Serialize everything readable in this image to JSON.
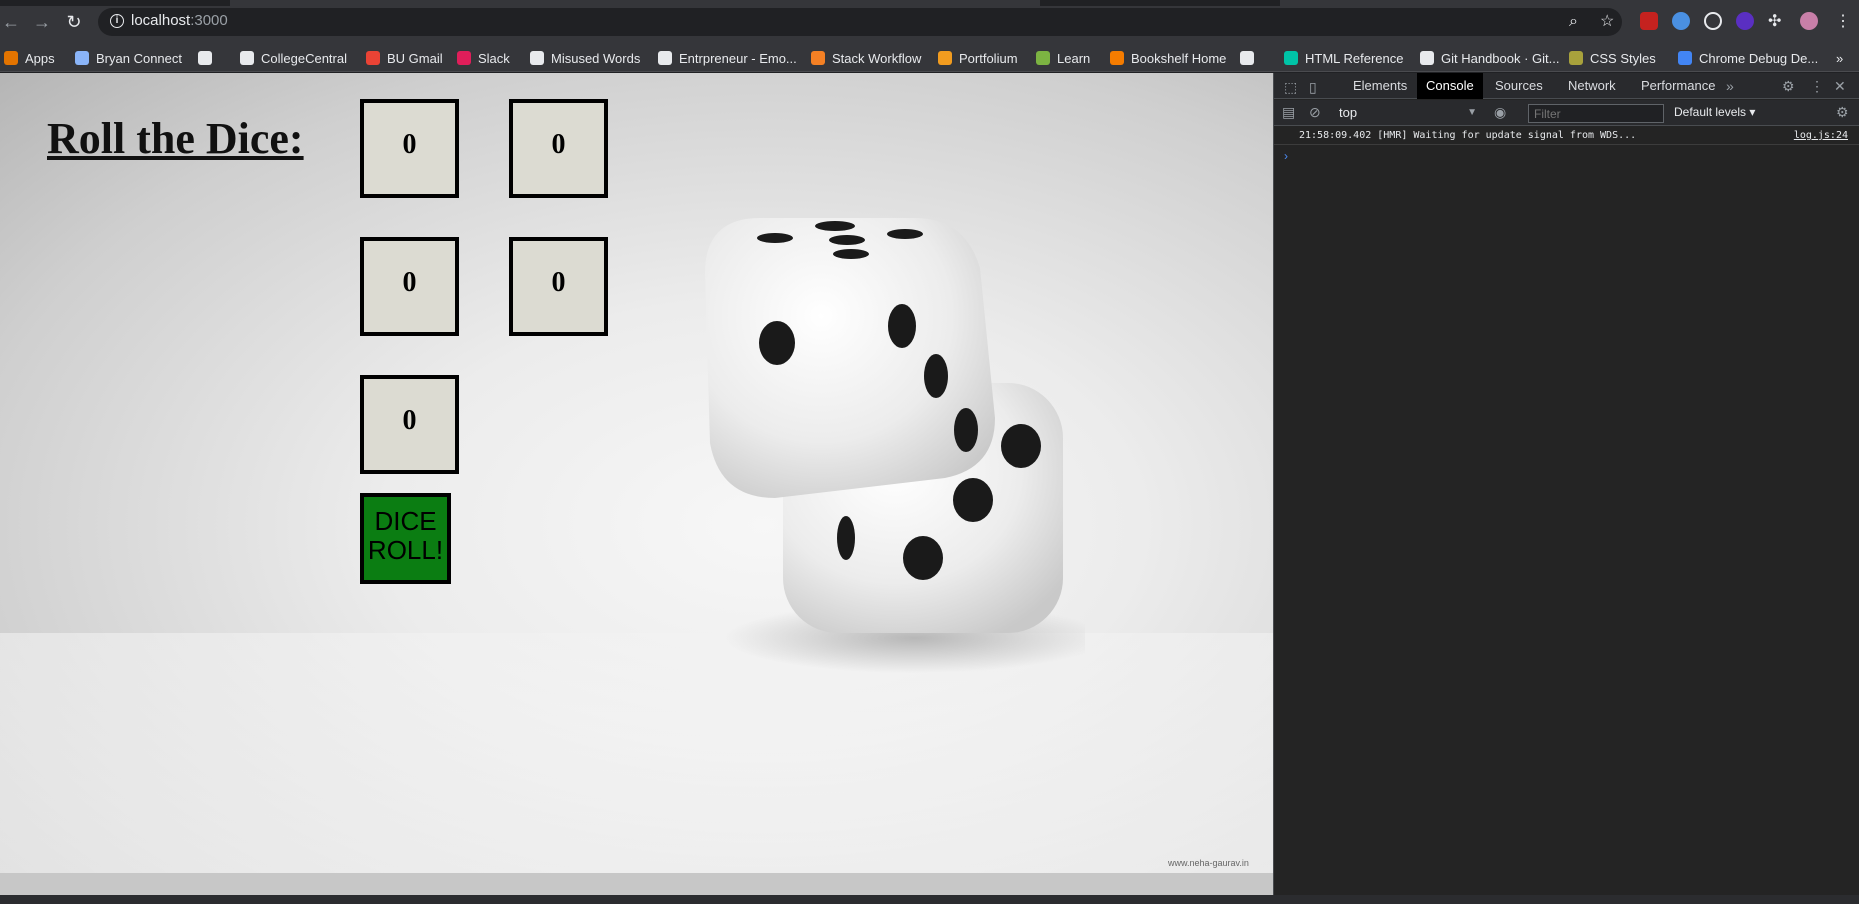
{
  "browser": {
    "url_host": "localhost",
    "url_port": ":3000",
    "bookmarks": [
      {
        "label": "Apps",
        "icon": "apps-grid-icon",
        "color": "#e37400"
      },
      {
        "label": "Bryan Connect",
        "icon": "bookmark-page-icon",
        "color": "#8ab4f8"
      },
      {
        "label": "",
        "icon": "github-icon",
        "color": "#e8eaed"
      },
      {
        "label": "CollegeCentral",
        "icon": "globe-icon",
        "color": "#e8eaed"
      },
      {
        "label": "BU Gmail",
        "icon": "gmail-icon",
        "color": "#ea4335"
      },
      {
        "label": "Slack",
        "icon": "slack-icon",
        "color": "#e01e5a"
      },
      {
        "label": "Misused Words",
        "icon": "e-letter-icon",
        "color": "#e8eaed"
      },
      {
        "label": "Entrpreneur - Emo...",
        "icon": "e-letter-icon",
        "color": "#e8eaed"
      },
      {
        "label": "Stack Workflow",
        "icon": "stack-icon",
        "color": "#f48024"
      },
      {
        "label": "Portfolium",
        "icon": "portfolium-icon",
        "color": "#f29c1f"
      },
      {
        "label": "Learn",
        "icon": "learn-icon",
        "color": "#7cb342"
      },
      {
        "label": "Bookshelf Home",
        "icon": "bookshelf-icon",
        "color": "#f57c00"
      },
      {
        "label": "",
        "icon": "chart-icon",
        "color": "#e8eaed"
      },
      {
        "label": "HTML Reference",
        "icon": "w-letter-icon",
        "color": "#00c4a7"
      },
      {
        "label": "Git Handbook · Git...",
        "icon": "github-icon",
        "color": "#e8eaed"
      },
      {
        "label": "CSS Styles",
        "icon": "css-icon",
        "color": "#a8a23c"
      },
      {
        "label": "Chrome Debug De...",
        "icon": "chrome-icon",
        "color": "#4285f4"
      }
    ],
    "more_bookmarks": "»"
  },
  "page": {
    "title": "Roll the Dice:",
    "dice_values": [
      "0",
      "0",
      "0",
      "0",
      "0"
    ],
    "roll_button_line1": "DICE",
    "roll_button_line2": "ROLL!",
    "watermark": "www.neha-gaurav.in"
  },
  "devtools": {
    "tabs": [
      "Elements",
      "Console",
      "Sources",
      "Network",
      "Performance"
    ],
    "active_tab": "Console",
    "context": "top",
    "filter_placeholder": "Filter",
    "levels": "Default levels ▾",
    "log_message": "21:58:09.402 [HMR] Waiting for update signal from WDS...",
    "log_source": "log.js:24",
    "prompt": "›"
  },
  "colors": {
    "die_box_bg": "#dcdbd2",
    "roll_button_bg": "#0b7d12",
    "chrome_bg": "#35363a",
    "devtools_bg": "#242424"
  }
}
